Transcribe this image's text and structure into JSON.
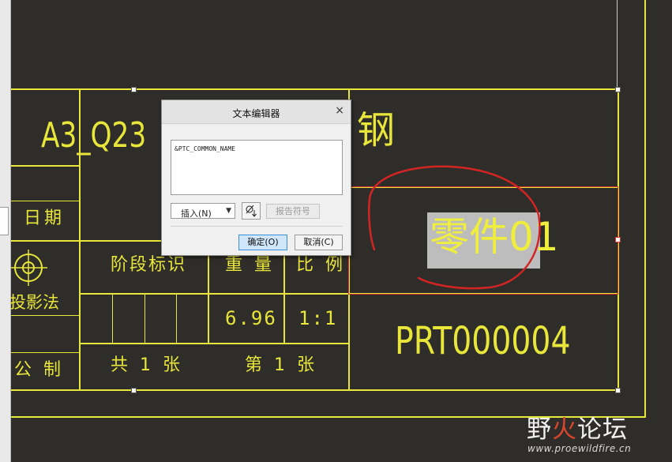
{
  "drawing": {
    "material_text": "A3_Q23",
    "material_char": "钢",
    "label_date": "日期",
    "label_projection": "投影法",
    "label_company": "公 制",
    "label_stage": "阶段标识",
    "label_weight": "重 量",
    "label_scale": "比 例",
    "weight_value": "6.96",
    "scale_value": "1:1",
    "sheets_total": "共 1 张",
    "sheet_number": "第 1 张",
    "part_name": "零件01",
    "part_number": "PRT000004"
  },
  "dialog": {
    "title": "文本编辑器",
    "text_content": "&PTC_COMMON_NAME",
    "insert_label": "插入(N)",
    "report_symbol_label": "报告符号",
    "ok_label": "确定(O)",
    "cancel_label": "取消(C)",
    "close_icon": "×"
  },
  "watermark": {
    "logo_prefix": "野",
    "logo_accent": "火",
    "logo_suffix": "论坛",
    "url": "www.proewildfire.cn"
  },
  "colors": {
    "background": "#2f2d29",
    "line": "#e8e63a",
    "annotation": "#d33333",
    "ok_button": "#cfe6fb"
  }
}
